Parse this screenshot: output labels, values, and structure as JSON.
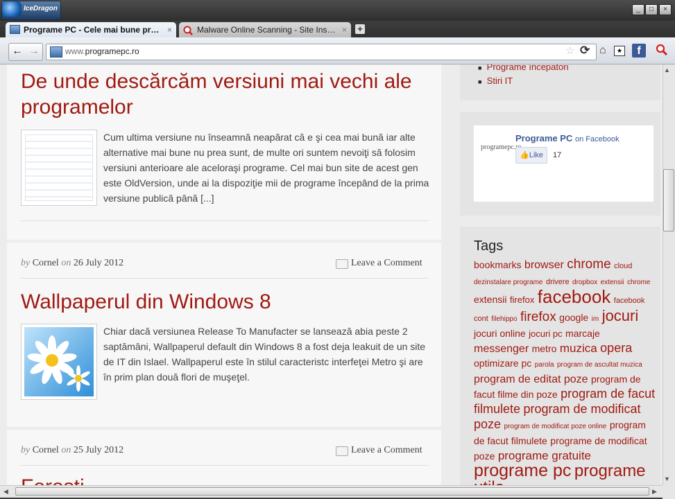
{
  "browser": {
    "name": "IceDragon",
    "tabs": [
      {
        "label": "Programe PC - Cele mai bune progr...",
        "active": true
      },
      {
        "label": "Malware Online Scanning - Site Insp...",
        "active": false
      }
    ],
    "url_prefix": "www.",
    "url_domain": "programepc.ro",
    "new_tab": "+",
    "back": "←",
    "forward": "→",
    "close": "×"
  },
  "sidebar": {
    "links": [
      "Programe începători",
      "Stiri IT"
    ],
    "facebook": {
      "logo": "programepc.ro",
      "title": "Programe PC",
      "suffix": "on Facebook",
      "like_label": "Like",
      "like_count": "17"
    },
    "tags_title": "Tags",
    "tags": [
      {
        "t": "bookmarks",
        "s": 14
      },
      {
        "t": "browser",
        "s": 16
      },
      {
        "t": "chrome",
        "s": 19
      },
      {
        "t": "cloud",
        "s": 11
      },
      {
        "t": "dezinstalare programe",
        "s": 10
      },
      {
        "t": "drivere",
        "s": 11
      },
      {
        "t": "dropbox",
        "s": 10
      },
      {
        "t": "extensii",
        "s": 10
      },
      {
        "t": "chrome",
        "s": 10
      },
      {
        "t": "extensii",
        "s": 14
      },
      {
        "t": "firefox",
        "s": 13
      },
      {
        "t": "facebook",
        "s": 26
      },
      {
        "t": "facebook cont",
        "s": 11
      },
      {
        "t": "filehippo",
        "s": 10
      },
      {
        "t": "firefox",
        "s": 19
      },
      {
        "t": "google",
        "s": 14
      },
      {
        "t": "im",
        "s": 10
      },
      {
        "t": "jocuri",
        "s": 22
      },
      {
        "t": "jocuri online",
        "s": 14
      },
      {
        "t": "jocuri pc",
        "s": 13
      },
      {
        "t": "marcaje",
        "s": 14
      },
      {
        "t": "messenger",
        "s": 16
      },
      {
        "t": "metro",
        "s": 14
      },
      {
        "t": "muzica",
        "s": 17
      },
      {
        "t": "opera",
        "s": 18
      },
      {
        "t": "optimizare pc",
        "s": 14
      },
      {
        "t": "parola",
        "s": 10
      },
      {
        "t": "program de ascultat muzica",
        "s": 10
      },
      {
        "t": "program de editat poze",
        "s": 16
      },
      {
        "t": "program de facut filme din poze",
        "s": 14
      },
      {
        "t": "program de facut filmulete",
        "s": 18
      },
      {
        "t": "program de modificat poze",
        "s": 18
      },
      {
        "t": "program de modificat poze online",
        "s": 10
      },
      {
        "t": "program de facut filmulete",
        "s": 14
      },
      {
        "t": "programe de modificat poze",
        "s": 14
      },
      {
        "t": "programe gratuite",
        "s": 17
      },
      {
        "t": "programe pc",
        "s": 25
      },
      {
        "t": "programe utile",
        "s": 24
      }
    ]
  },
  "posts": [
    {
      "title": "De unde descărcăm versiuni mai vechi ale programelor",
      "excerpt": "Cum ultima versiune nu înseamnă neapărat că e şi cea mai bună iar alte alternative mai bune nu prea sunt, de multe ori suntem nevoiţi să folosim versiuni anterioare ale aceloraşi programe. Cel mai bun site de acest gen este OldVersion, unde ai la dispoziţie mii de programe începând de la prima versiune publică până [...]"
    },
    {
      "title": "Wallpaperul din Windows 8",
      "excerpt": "Chiar dacă versiunea Release To Manufacter se lansează abia peste 2 saptămâni, Wallpaperul default din Windows 8 a fost deja leakuit de un site de IT din Islael. Wallpaperul este în stilul caracteristc interfeţei Metro şi are în prim plan două flori de muşeţel.",
      "meta_by": "by",
      "author": "Cornel",
      "meta_on": "on",
      "date": "26 July 2012",
      "comment": "Leave a Comment"
    },
    {
      "title": "Fereşti",
      "meta_by": "by",
      "author": "Cornel",
      "meta_on": "on",
      "date": "25 July 2012",
      "comment": "Leave a Comment"
    }
  ],
  "colors": {
    "title_red": "#a01a12",
    "facebook_blue": "#3b5998"
  }
}
